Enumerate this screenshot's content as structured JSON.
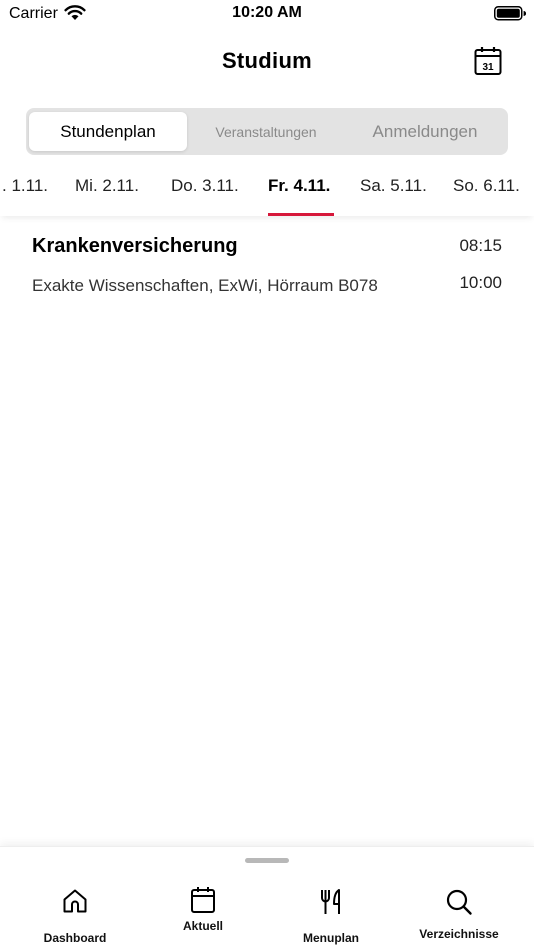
{
  "status_bar": {
    "carrier": "Carrier",
    "time": "10:20 AM"
  },
  "header": {
    "title": "Studium",
    "calendar_icon_day": "31"
  },
  "segments": [
    {
      "label": "Stundenplan",
      "selected": true
    },
    {
      "label": "Veranstaltungen",
      "selected": false
    },
    {
      "label": "Anmeldungen",
      "selected": false
    }
  ],
  "days": [
    {
      "label": ". 1.11.",
      "selected": false
    },
    {
      "label": "Mi. 2.11.",
      "selected": false
    },
    {
      "label": "Do. 3.11.",
      "selected": false
    },
    {
      "label": "Fr. 4.11.",
      "selected": true
    },
    {
      "label": "Sa. 5.11.",
      "selected": false
    },
    {
      "label": "So. 6.11.",
      "selected": false
    }
  ],
  "entry": {
    "title": "Krankenversicherung",
    "location": "Exakte Wissenschaften, ExWi, Hörraum B078",
    "start": "08:15",
    "end": "10:00"
  },
  "tabs": [
    {
      "label": "Dashboard",
      "icon": "home-icon"
    },
    {
      "label": "Aktuell",
      "icon": "calendar-icon"
    },
    {
      "label": "Menuplan",
      "icon": "fork-knife-icon"
    },
    {
      "label": "Verzeichnisse",
      "icon": "search-icon"
    }
  ],
  "colors": {
    "accent": "#d6173a",
    "segment_bg": "#e3e3e3"
  }
}
